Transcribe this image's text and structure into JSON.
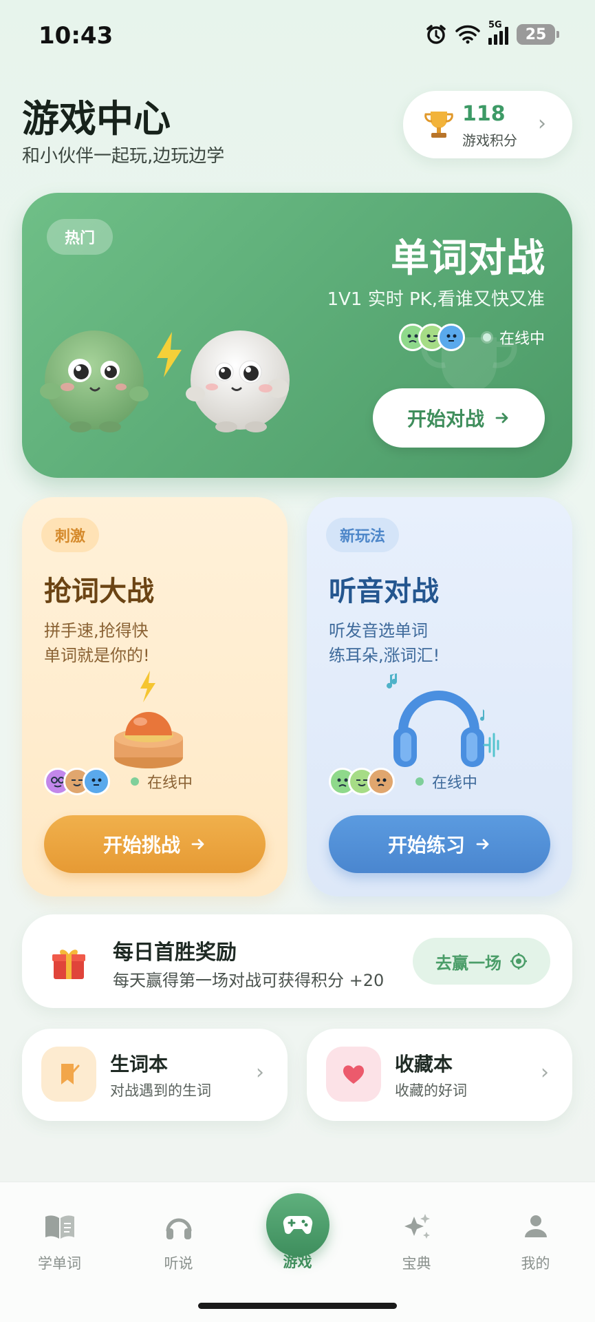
{
  "status_bar": {
    "time": "10:43",
    "network": "5G",
    "battery": "25"
  },
  "header": {
    "title": "游戏中心",
    "subtitle": "和小伙伴一起玩,边玩边学"
  },
  "score": {
    "value": "118",
    "label": "游戏积分"
  },
  "hero": {
    "badge": "热门",
    "title": "单词对战",
    "subtitle": "1V1 实时 PK,看谁又快又准",
    "online": "在线中",
    "button": "开始对战"
  },
  "cards": [
    {
      "tag": "刺激",
      "title": "抢词大战",
      "desc_line1": "拼手速,抢得快",
      "desc_line2": "单词就是你的!",
      "online": "在线中",
      "button": "开始挑战"
    },
    {
      "tag": "新玩法",
      "title": "听音对战",
      "desc_line1": "听发音选单词",
      "desc_line2": "练耳朵,涨词汇!",
      "online": "在线中",
      "button": "开始练习"
    }
  ],
  "reward": {
    "title": "每日首胜奖励",
    "desc": "每天赢得第一场对战可获得积分 +20",
    "button": "去赢一场"
  },
  "shortcuts": [
    {
      "title": "生词本",
      "desc": "对战遇到的生词"
    },
    {
      "title": "收藏本",
      "desc": "收藏的好词"
    }
  ],
  "tabs": [
    {
      "label": "学单词"
    },
    {
      "label": "听说"
    },
    {
      "label": "游戏"
    },
    {
      "label": "宝典"
    },
    {
      "label": "我的"
    }
  ],
  "colors": {
    "primary_green": "#4c9a67",
    "orange": "#e69a34",
    "blue": "#4a86cf"
  }
}
